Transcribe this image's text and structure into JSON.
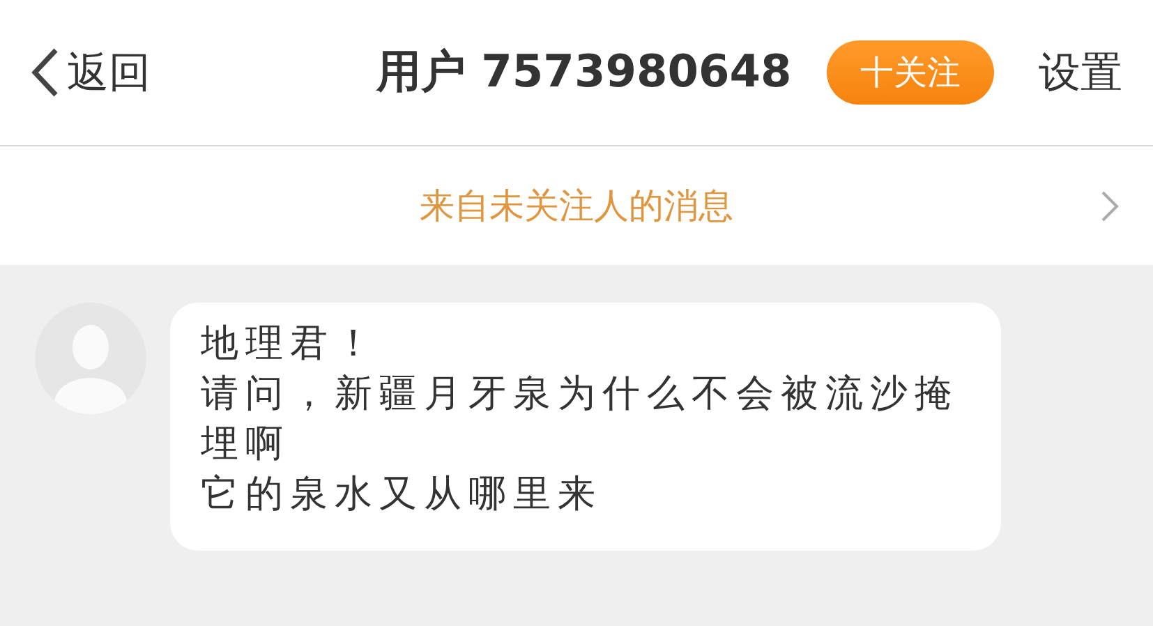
{
  "nav_bar": {
    "back": "返回",
    "title": "用户 7573980648",
    "follow_button": "十关注",
    "settings": "设置"
  },
  "notice_bar": {
    "text": "来自未关注人的消息"
  },
  "messages": [
    {
      "lines": [
        "地理君！",
        "请问，新疆月牙泉为什么不会被流沙掩埋啊",
        "它的泉水又从哪里来"
      ]
    }
  ]
}
